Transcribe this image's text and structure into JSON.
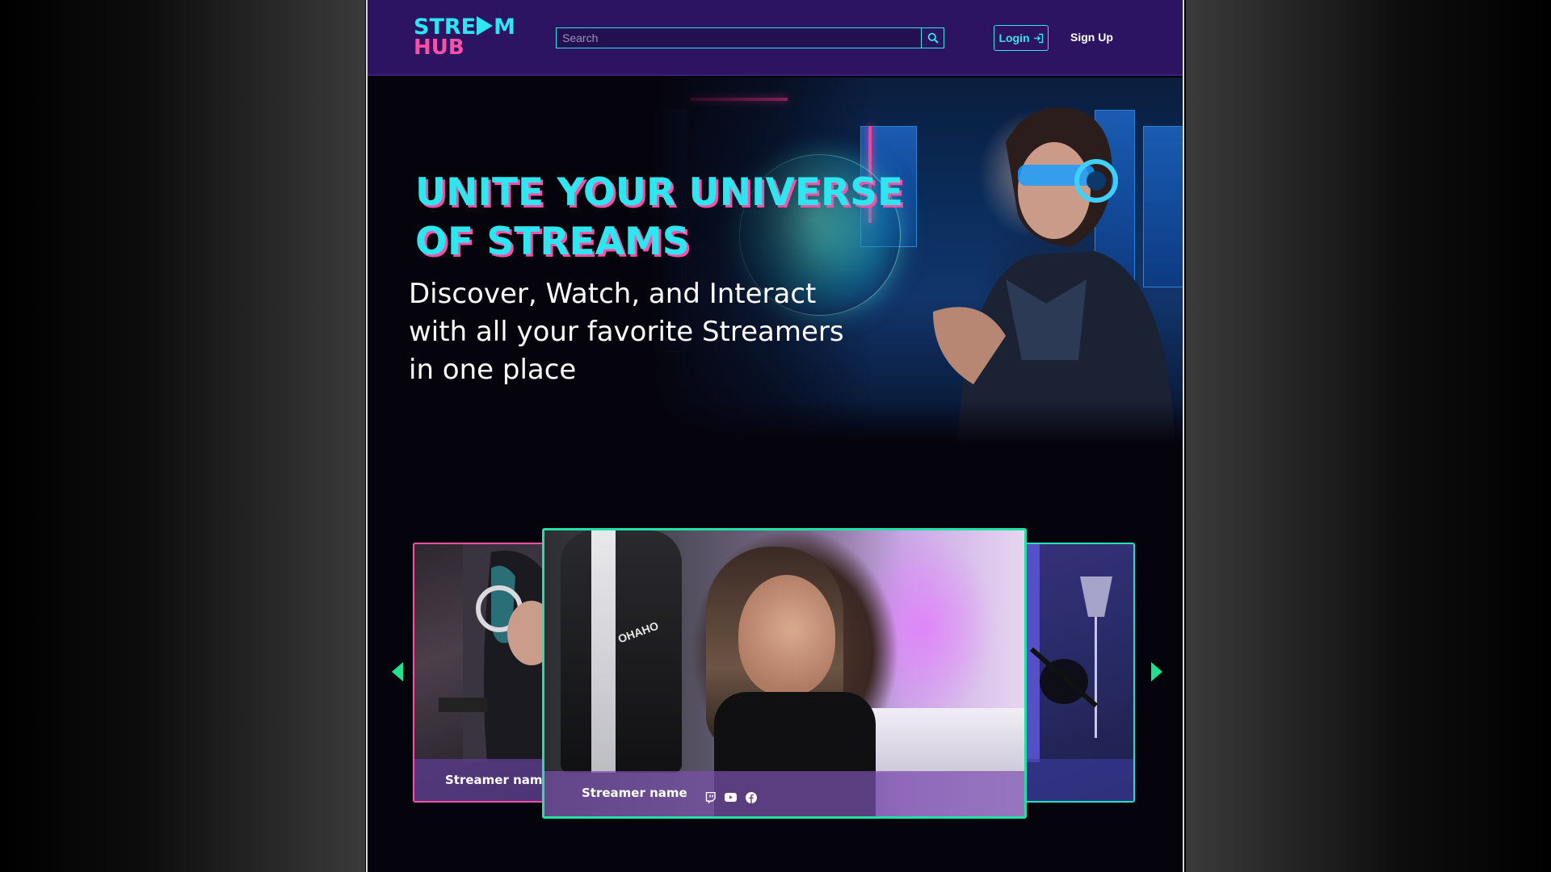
{
  "header": {
    "logo_line1_a": "STRE",
    "logo_line1_b": "M",
    "logo_line2": "HUB",
    "search_placeholder": "Search",
    "login_label": "Login",
    "signup_label": "Sign Up"
  },
  "hero": {
    "title_line1": "UNITE YOUR UNIVERSE",
    "title_line2": "OF STREAMS",
    "subtitle_line1": "Discover, Watch, and Interact",
    "subtitle_line2": "with all your favorite Streamers",
    "subtitle_line3": "in one place"
  },
  "carousel": {
    "cards": [
      {
        "name": "Streamer nam"
      },
      {
        "name": "Streamer name",
        "chair_brand": "OHAHO",
        "socials": [
          "twitch-icon",
          "youtube-icon",
          "facebook-icon"
        ]
      },
      {
        "name": ""
      }
    ]
  },
  "colors": {
    "header_bg": "#2c1462",
    "accent_cyan": "#2ee6f0",
    "accent_pink": "#ff4fa7",
    "accent_green": "#1fe28e",
    "page_bg": "#05030c"
  }
}
